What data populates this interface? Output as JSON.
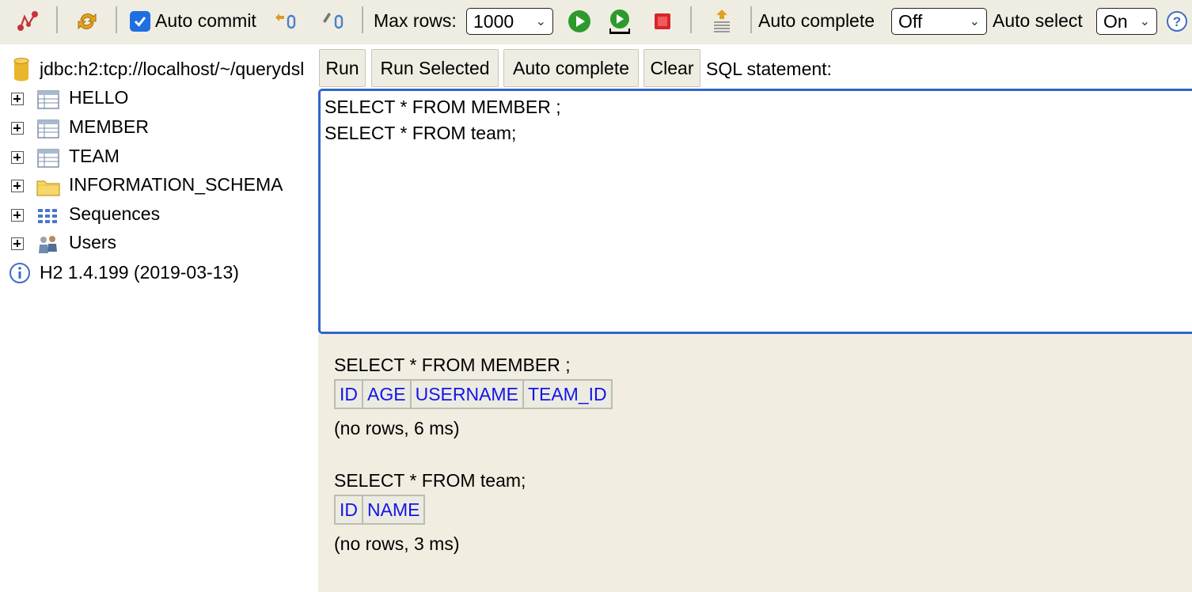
{
  "toolbar": {
    "auto_commit_label": "Auto commit",
    "auto_commit_checked": true,
    "max_rows_label": "Max rows:",
    "max_rows_value": "1000",
    "auto_complete_label": "Auto complete",
    "auto_complete_value": "Off",
    "auto_select_label": "Auto select",
    "auto_select_value": "On",
    "icons": [
      "disconnect-icon",
      "refresh-icon",
      "rollback-icon",
      "commit-icon",
      "run-icon",
      "run-selected-icon",
      "cancel-icon",
      "history-icon",
      "help-icon"
    ]
  },
  "tree": {
    "connection": "jdbc:h2:tcp://localhost/~/querydsl",
    "items": [
      {
        "label": "HELLO",
        "icon": "table-icon"
      },
      {
        "label": "MEMBER",
        "icon": "table-icon"
      },
      {
        "label": "TEAM",
        "icon": "table-icon"
      },
      {
        "label": "INFORMATION_SCHEMA",
        "icon": "folder-icon"
      },
      {
        "label": "Sequences",
        "icon": "sequences-icon"
      },
      {
        "label": "Users",
        "icon": "users-icon"
      }
    ],
    "version": "H2 1.4.199 (2019-03-13)"
  },
  "query": {
    "buttons": {
      "run": "Run",
      "run_selected": "Run Selected",
      "auto_complete": "Auto complete",
      "clear": "Clear"
    },
    "sql_label": "SQL statement:",
    "sql_text": "SELECT * FROM MEMBER ;\nSELECT * FROM team;"
  },
  "results": [
    {
      "sql": "SELECT * FROM MEMBER ;",
      "columns": [
        "ID",
        "AGE",
        "USERNAME",
        "TEAM_ID"
      ],
      "info": "(no rows, 6 ms)"
    },
    {
      "sql": "SELECT * FROM team;",
      "columns": [
        "ID",
        "NAME"
      ],
      "info": "(no rows, 3 ms)"
    }
  ],
  "colors": {
    "accent": "#2f66c9",
    "toolbar_bg": "#efede1",
    "results_bg": "#f1eee1",
    "column_header": "#1414e8"
  }
}
